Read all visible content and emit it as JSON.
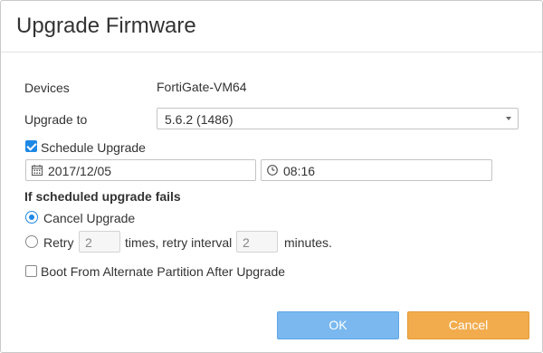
{
  "dialog": {
    "title": "Upgrade Firmware"
  },
  "devices": {
    "label": "Devices",
    "value": "FortiGate-VM64"
  },
  "upgrade_to": {
    "label": "Upgrade to",
    "selected": "5.6.2 (1486)"
  },
  "schedule": {
    "label": "Schedule Upgrade",
    "checked": true,
    "date": "2017/12/05",
    "time": "08:16",
    "date_icon": "calendar-icon",
    "time_icon": "clock-icon"
  },
  "fail_section": {
    "heading": "If scheduled upgrade fails",
    "cancel_label": "Cancel Upgrade",
    "retry_label": "Retry",
    "retry_count": "2",
    "times_label": "times, retry interval",
    "interval": "2",
    "minutes_label": "minutes."
  },
  "boot_alt": {
    "label": "Boot From Alternate Partition After Upgrade",
    "checked": false
  },
  "buttons": {
    "ok": "OK",
    "cancel": "Cancel"
  },
  "colors": {
    "accent": "#1e88e5",
    "ok_button": "#7ab8ef",
    "cancel_button": "#f2ac4d"
  }
}
